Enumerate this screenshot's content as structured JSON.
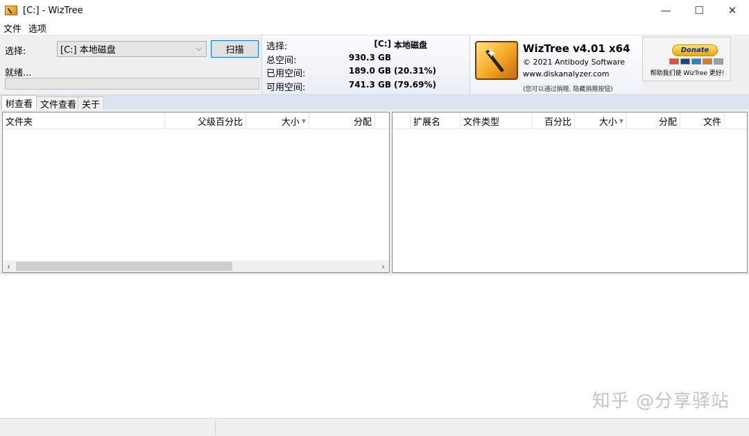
{
  "window": {
    "title": "[C:]  - WizTree",
    "minimize_glyph": "—",
    "maximize_glyph": "☐",
    "close_glyph": "✕"
  },
  "menu": [
    "文件",
    "选项"
  ],
  "scan": {
    "select_label": "选择:",
    "drive_value": "[C:] 本地磁盘",
    "scan_button": "扫描",
    "status_text": "就绪...",
    "progress": 0
  },
  "disk_info": {
    "select_label": "选择:",
    "drive_letter": "[C:]",
    "drive_name": "本地磁盘",
    "rows": [
      {
        "label": "总空间:",
        "value": "930.3 GB",
        "percent": ""
      },
      {
        "label": "已用空间:",
        "value": "189.0 GB",
        "percent": "(20.31%)"
      },
      {
        "label": "可用空间:",
        "value": "741.3 GB",
        "percent": "(79.69%)"
      }
    ]
  },
  "brand": {
    "title": "WizTree v4.01 x64",
    "copyright": "© 2021 Antibody Software",
    "url": "www.diskanalyzer.com",
    "note": "(您可以通过捐赠, 隐藏捐赠按钮)"
  },
  "donate": {
    "button": "Donate",
    "text": "帮助我们使 WizTree 更好!"
  },
  "tabs": [
    "树查看",
    "文件查看",
    "关于"
  ],
  "tree_columns": [
    "文件夹",
    "父级百分比",
    "大小",
    "分配"
  ],
  "type_columns": [
    "扩展名",
    "文件类型",
    "百分比",
    "大小",
    "分配",
    "文件"
  ],
  "watermark": "知乎 @分享驿站",
  "colors": {
    "accent": "#0078d7",
    "tab_strip": "#dbe5f1",
    "panel": "#f0f0f0"
  }
}
